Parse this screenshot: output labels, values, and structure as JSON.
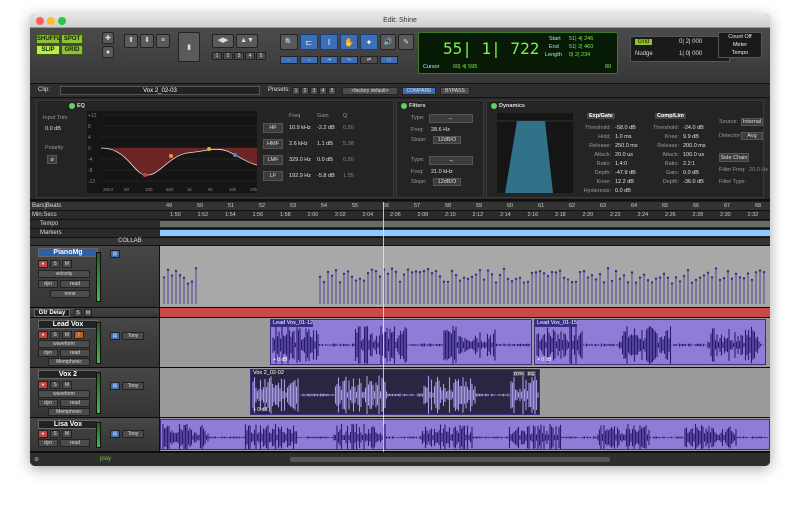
{
  "window": {
    "title": "Edit: Shine"
  },
  "toolbar": {
    "modes": {
      "shuffle": "SHUFFLE",
      "spot": "SPOT",
      "slip": "SLIP",
      "grid": "GRID"
    },
    "zoom_presets": [
      "1",
      "2",
      "3",
      "4",
      "5"
    ],
    "counter": {
      "main": "55| 1| 722",
      "start_label": "Start",
      "start": "51| 4| 246",
      "end_label": "End",
      "end": "51| 2| 460",
      "length_label": "Length",
      "length": "0| 2| 234",
      "cursor_label": "Cursor",
      "cursor": "60| 4| 595",
      "tempo": "80"
    },
    "grid": {
      "label": "Grid",
      "value": "0| 2| 000"
    },
    "nudge": {
      "label": "Nudge",
      "value": "1| 0| 000"
    },
    "count_off": "Count Off",
    "meter": "Meter",
    "tempo_label": "Tempo"
  },
  "clip_bar": {
    "clip_label": "Clip:",
    "clip_name": "Vox 2_02-03",
    "presets_label": "Presets:",
    "presets": [
      "1",
      "2",
      "3",
      "4",
      "5"
    ],
    "preset_name": "<factory default>",
    "compare": "COMPARE",
    "bypass": "BYPASS"
  },
  "eq": {
    "title": "EQ",
    "input_trim_label": "Input Trim",
    "input_trim": "0.0 dB",
    "polarity_label": "Polarity",
    "col_freq": "Freq",
    "col_gain": "Gain",
    "col_q": "Q",
    "bands": [
      {
        "name": "HF",
        "freq": "10.9 kHz",
        "gain": "-2.2 dB",
        "q": "0.50"
      },
      {
        "name": "HMF",
        "freq": "2.6 kHz",
        "gain": "1.1 dB",
        "q": "5.38"
      },
      {
        "name": "LMF",
        "freq": "329.0 Hz",
        "gain": "0.0 dB",
        "q": "0.50"
      },
      {
        "name": "LF",
        "freq": "192.9 Hz",
        "gain": "-5.8 dB",
        "q": "1.55"
      }
    ],
    "freq_ticks": [
      "20Hz",
      "50",
      "100",
      "500",
      "1k",
      "5k",
      "10k",
      "20k"
    ],
    "gain_ticks": [
      "+12",
      "8",
      "4",
      "0",
      "-4",
      "-8",
      "-12"
    ]
  },
  "filters": {
    "title": "Filters",
    "type_label": "Type:",
    "freq_label": "Freq:",
    "slope_label": "Slope:",
    "hpf": {
      "freq": "28.6 Hz",
      "slope": "12dB/O"
    },
    "lpf": {
      "freq": "21.0 kHz",
      "slope": "12dB/O"
    }
  },
  "dynamics": {
    "title": "Dynamics",
    "expgate": {
      "title": "Exp/Gate",
      "rows": [
        {
          "label": "Threshold:",
          "value": "-58.0 dB"
        },
        {
          "label": "Hold:",
          "value": "1.0 ms"
        },
        {
          "label": "Release:",
          "value": "250.0 ms"
        },
        {
          "label": "Attack:",
          "value": "20.0 us"
        },
        {
          "label": "Ratio:",
          "value": "1.4:0"
        },
        {
          "label": "Depth:",
          "value": "-47.9 dB"
        },
        {
          "label": "Knee:",
          "value": "12.2 dB"
        },
        {
          "label": "Hysteresis:",
          "value": "0.0 dB"
        }
      ]
    },
    "complim": {
      "title": "Comp/Lim",
      "rows": [
        {
          "label": "Threshold:",
          "value": "-24.0 dB"
        },
        {
          "label": "Knee:",
          "value": "9.9 dB"
        },
        {
          "label": "Release:",
          "value": "200.0 ms"
        },
        {
          "label": "Attack:",
          "value": "100.0 us"
        },
        {
          "label": "Ratio:",
          "value": "2.2:1"
        },
        {
          "label": "Gain:",
          "value": "0.0 dB"
        },
        {
          "label": "Depth:",
          "value": "-36.0 dB"
        }
      ]
    },
    "source_label": "Source:",
    "source": "Internal",
    "detector_label": "Detector:",
    "detector": "Avg",
    "side_chain": "Side Chain",
    "filter_freq_label": "Filter Freq:",
    "filter_freq": "20.0 Hz",
    "filter_type_label": "Filter Type:"
  },
  "rulers": {
    "bars_label": "Bars|Beats",
    "minsecs_label": "Min:Secs",
    "tempo_label": "Tempo",
    "markers_label": "Markers",
    "bars": [
      "49",
      "50",
      "51",
      "52",
      "53",
      "54",
      "55",
      "56",
      "57",
      "58",
      "59",
      "60",
      "61",
      "62",
      "63",
      "64",
      "65",
      "66",
      "67",
      "68"
    ],
    "times": [
      "1:50",
      "1:52",
      "1:54",
      "1:56",
      "1:58",
      "2:00",
      "2:02",
      "2:04",
      "2:06",
      "2:08",
      "2:10",
      "2:12",
      "2:14",
      "2:16",
      "2:18",
      "2:20",
      "2:22",
      "2:24",
      "2:26",
      "2:28",
      "2:30",
      "2:32"
    ]
  },
  "collab_label": "COLLAB",
  "tracks": [
    {
      "name": "PianoMg",
      "view": "velocity",
      "mode": "read",
      "dyn": "dyn",
      "extra": "none"
    },
    {
      "name": "Gtr Delay"
    },
    {
      "name": "Lead Vox",
      "view": "waveform",
      "dyn": "dyn",
      "mode": "read",
      "plugin": "Memphonic",
      "input": "Tony",
      "clips": [
        {
          "name": "Lead Vox_01-12",
          "gain": "+ 0 dB"
        },
        {
          "name": "Lead Vox_01-15",
          "gain": "+ 0 dB"
        }
      ]
    },
    {
      "name": "Vox 2",
      "view": "waveform",
      "dyn": "dyn",
      "mode": "read",
      "plugin": "Memphonic",
      "input": "Tony",
      "clips": [
        {
          "name": "Vox 2_02-02",
          "gain": "+ 0 dB",
          "badge1": "DYN",
          "badge2": "EQ"
        }
      ]
    },
    {
      "name": "Lisa Vox",
      "view": "waveform",
      "dyn": "dyn",
      "mode": "read",
      "input": "Tony"
    }
  ],
  "status": {
    "play": "play"
  }
}
